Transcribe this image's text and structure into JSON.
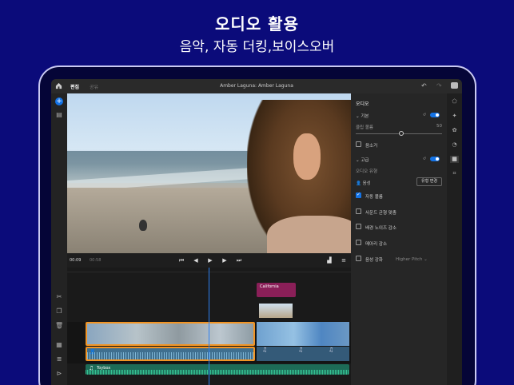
{
  "hero": {
    "title": "오디오 활용",
    "subtitle": "음악, 자동 더킹,보이스오버"
  },
  "app": {
    "tabs": {
      "edit": "편집",
      "share": "공유"
    },
    "project_title": "Amber Laguna: Amber Laguna",
    "undo_icon": "↶",
    "redo_icon": "↷"
  },
  "playback": {
    "current_time": "00:09",
    "duration": "00:58"
  },
  "timeline": {
    "title_clip_label": "California",
    "music_track_label": "Toybox"
  },
  "audio_panel": {
    "title": "오디오",
    "basic": {
      "label": "기본",
      "enabled": true
    },
    "volume": {
      "label": "클립 볼륨",
      "value": "50",
      "fraction": 0.5
    },
    "mute_label": "음소거",
    "advanced": {
      "label": "고급",
      "enabled": true
    },
    "audio_type_label": "오디오 유형",
    "type_value": "음성",
    "change_type_button": "유형 변경",
    "options": [
      {
        "label": "자동 볼륨",
        "checked": true
      },
      {
        "label": "사운드 균형 맞춤",
        "checked": false
      },
      {
        "label": "배경 노이즈 감소",
        "checked": false
      },
      {
        "label": "메아리 감소",
        "checked": false
      },
      {
        "label": "음성 강화",
        "checked": false
      }
    ],
    "enhance_dropdown": "Higher Pitch"
  },
  "colors": {
    "accent": "#1473e6",
    "selection": "#f29423",
    "hero_bg": "#0b0b7a",
    "title_clip": "#8a1f58",
    "music_track": "#1d6b57"
  }
}
